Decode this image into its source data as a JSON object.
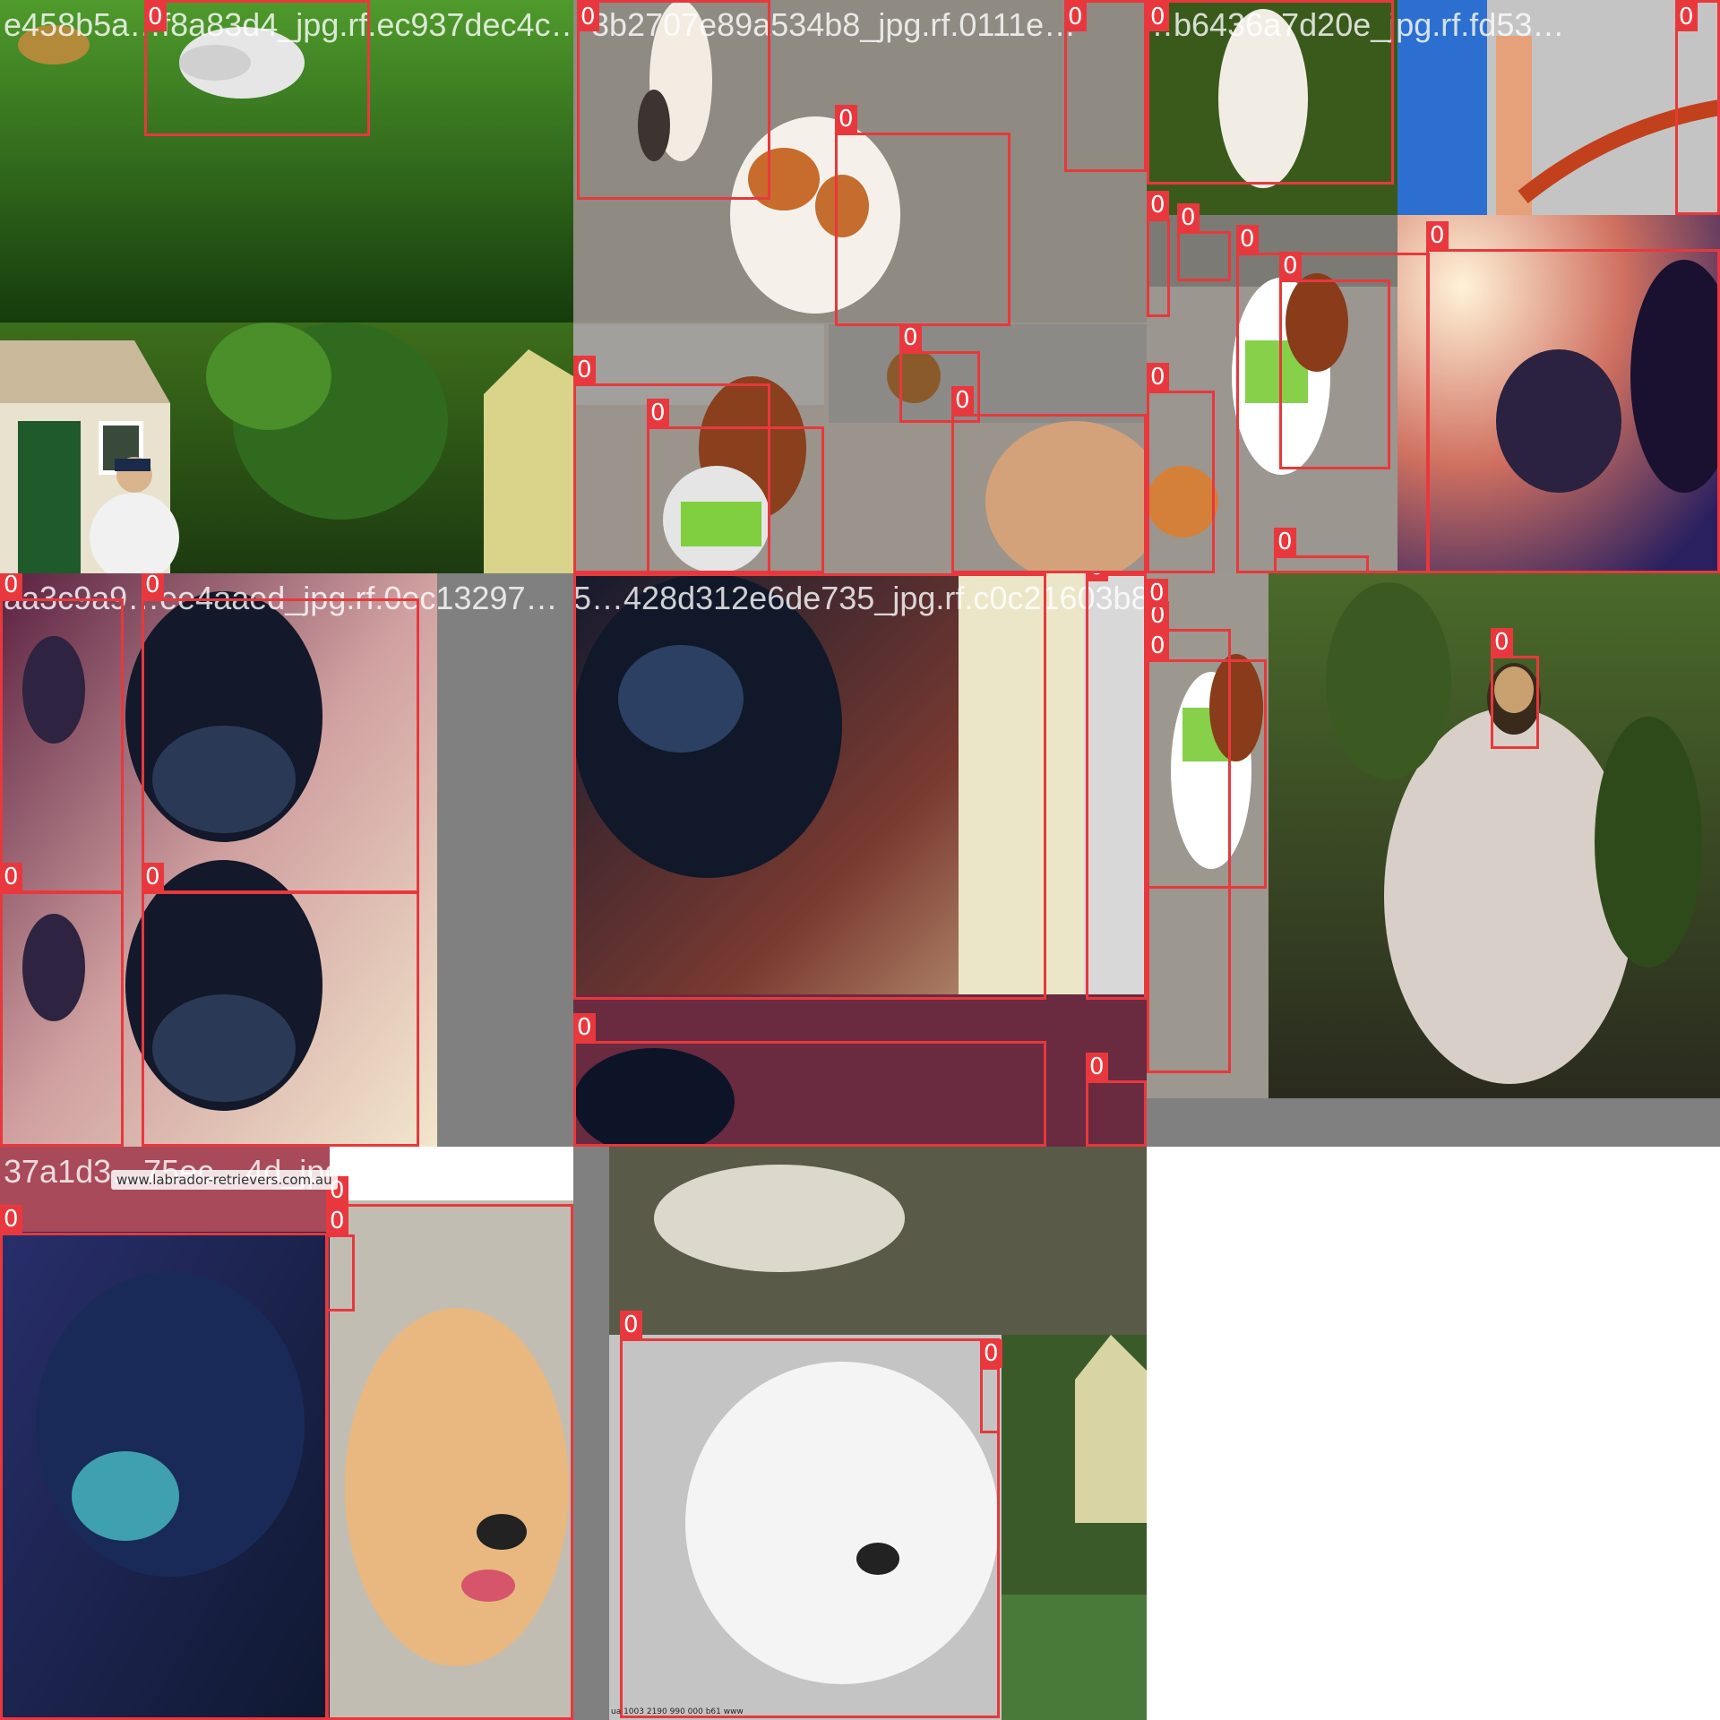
{
  "tiles": [
    {
      "id": "t1",
      "filename": "e458b5a…f8a83d4_jpg.rf.ec937dec4c…",
      "labels": [
        "0"
      ]
    },
    {
      "id": "t2",
      "filename": "3b2707e89a534b8_jpg.rf.0111e…",
      "labels": [
        "0",
        "0",
        "0",
        "0",
        "0",
        "0",
        "0"
      ]
    },
    {
      "id": "t3",
      "filename": "…b6436a7d20e_jpg.rf.fd53…",
      "labels": [
        "0",
        "0",
        "0",
        "0",
        "0",
        "0",
        "0",
        "0",
        "0",
        "0"
      ]
    },
    {
      "id": "t4",
      "filename": "aa3c9a9…ee4aaed_jpg.rf.0ec13297…",
      "labels": [
        "0",
        "0",
        "0",
        "0"
      ]
    },
    {
      "id": "t5",
      "filename": "5…428d312e6de735_jpg.rf.c0c21603b884e875ed7230da_jpg.rf.0c0494a71",
      "labels": [
        "0",
        "0",
        "0",
        "0",
        "0",
        "0",
        "0"
      ]
    },
    {
      "id": "t7",
      "filename": "37a1d3…75ec…4d_jpg.rf.5f4e53a7bd8376ca0aa9…e63da_jpg.rf.5cdeacdd79ae70da",
      "labels": [
        "0",
        "0",
        "0",
        "0",
        "0"
      ]
    }
  ],
  "watermark_text": "www.labrador-retrievers.com.au",
  "footer_text": "ua 1003 2190 990 000 b61 www",
  "box_color": "#e8383d"
}
